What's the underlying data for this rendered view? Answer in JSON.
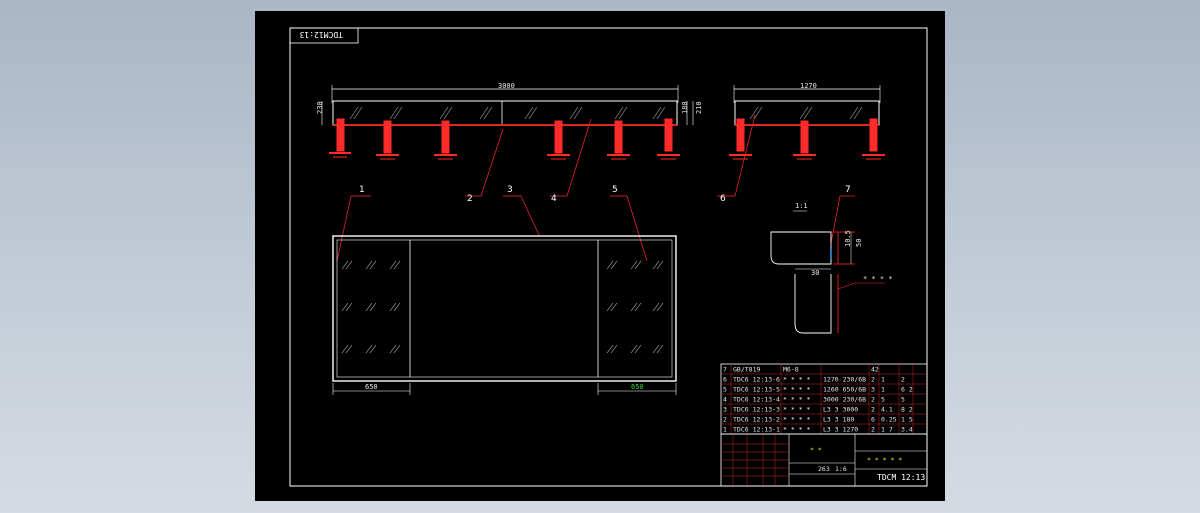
{
  "drawing": {
    "title_block_mirror": "TDCM12:13",
    "drawing_number": "TDCM 12:13",
    "scale": "1:1"
  },
  "front_view": {
    "length": "3000",
    "height_left": "230",
    "height_right_a": "180",
    "height_right_b": "210"
  },
  "side_view": {
    "length": "1270"
  },
  "plan_view": {
    "left_width": "650",
    "right_width": "650"
  },
  "detail": {
    "scale": "1:1",
    "dim_a": "50",
    "dim_b": "10.5",
    "dim_c": "30"
  },
  "balloons": [
    "1",
    "2",
    "3",
    "4",
    "5",
    "6",
    "7"
  ],
  "parts_list": [
    {
      "no": "7",
      "code": "GB/T819",
      "name": "M6-8",
      "spec": "",
      "qty": "42",
      "c1": "",
      "c2": ""
    },
    {
      "no": "6",
      "code": "TDC6 12:13-6",
      "name": "* * * *",
      "spec": "1270 230/6B",
      "qty": "2",
      "c1": "1",
      "c2": "2"
    },
    {
      "no": "5",
      "code": "TDC6 12:13-5",
      "name": "* * * *",
      "spec": "1260 650/6B",
      "qty": "3",
      "c1": "1",
      "c2": "6 2"
    },
    {
      "no": "4",
      "code": "TDC6 12:13-4",
      "name": "* * * *",
      "spec": "3000 230/6B",
      "qty": "2",
      "c1": "5",
      "c2": "5"
    },
    {
      "no": "3",
      "code": "TDC6 12:13-3",
      "name": "* * * *",
      "spec": "L3 3 3000",
      "qty": "2",
      "c1": "4.1",
      "c2": "8 2"
    },
    {
      "no": "2",
      "code": "TDC6 12:13-2",
      "name": "* * * *",
      "spec": "L3 3 180",
      "qty": "6",
      "c1": "0.25",
      "c2": "1 5"
    },
    {
      "no": "1",
      "code": "TDC6 12:13-1",
      "name": "* * * *",
      "spec": "L3 3 1270",
      "qty": "2",
      "c1": "1 7",
      "c2": "3.4"
    }
  ],
  "title_block": {
    "company": "* * * * *",
    "drawing_no": "TDCM 12:13",
    "weight": "263",
    "scale": "1:6",
    "part_name": "* *"
  },
  "colors": {
    "sheet": "#000000",
    "frame": "#ffffff",
    "part": "#ff2a2a",
    "dimension": "#ffffff",
    "green": "#38d038"
  }
}
